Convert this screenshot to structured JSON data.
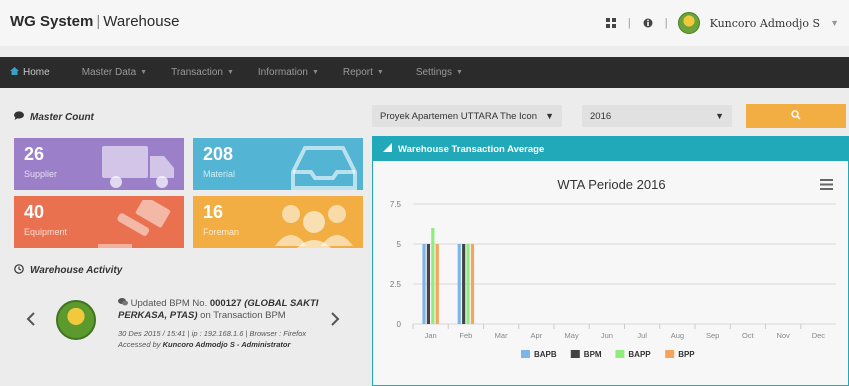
{
  "header": {
    "brand_bold": "WG System",
    "brand_sep": "|",
    "brand_rest": "Warehouse",
    "divider": "|",
    "username": "Kuncoro Admodjo S"
  },
  "nav": {
    "items": [
      {
        "label": "Home",
        "icon": "home-icon"
      },
      {
        "label": "Master Data"
      },
      {
        "label": "Transaction"
      },
      {
        "label": "Information"
      },
      {
        "label": "Report"
      },
      {
        "label": "Settings"
      }
    ]
  },
  "master": {
    "title": "Master Count",
    "tiles": [
      {
        "value": "26",
        "label": "Supplier",
        "color": "#9c7fc9",
        "icon": "truck-icon"
      },
      {
        "value": "208",
        "label": "Material",
        "color": "#54b4d4",
        "icon": "inbox-tray-icon"
      },
      {
        "value": "40",
        "label": "Equipment",
        "color": "#e9714f",
        "icon": "hammer-icon"
      },
      {
        "value": "16",
        "label": "Foreman",
        "color": "#f2ae42",
        "icon": "users-icon"
      }
    ]
  },
  "activity": {
    "title": "Warehouse Activity",
    "line_prefix": "Updated BPM No. ",
    "doc_no": "000127",
    "company": "(GLOBAL SAKTI PERKASA, PTAS)",
    "line_suffix": "on Transaction BPM",
    "meta_line": "30 Des 2015 / 15:41 | ip : 192.168.1.6 | Browser : Firefox",
    "accessed_prefix": "Accessed by ",
    "accessed_by": "Kuncoro Admodjo S - Administrator"
  },
  "filters": {
    "project": "Proyek Apartemen UTTARA The Icon",
    "year": "2016"
  },
  "chart_panel": {
    "header": "Warehouse Transaction Average"
  },
  "chart_data": {
    "type": "bar",
    "title": "WTA Periode 2016",
    "categories": [
      "Jan",
      "Feb",
      "Mar",
      "Apr",
      "May",
      "Jun",
      "Jul",
      "Aug",
      "Sep",
      "Oct",
      "Nov",
      "Dec"
    ],
    "ylim": [
      0,
      7.5
    ],
    "yticks": [
      "0",
      "2.5",
      "5",
      "7.5"
    ],
    "series": [
      {
        "name": "BAPB",
        "color": "#7cb5ec",
        "values": [
          5,
          5,
          0,
          0,
          0,
          0,
          0,
          0,
          0,
          0,
          0,
          0
        ]
      },
      {
        "name": "BPM",
        "color": "#434348",
        "values": [
          5,
          5,
          0,
          0,
          0,
          0,
          0,
          0,
          0,
          0,
          0,
          0
        ]
      },
      {
        "name": "BAPP",
        "color": "#90ed7d",
        "values": [
          6,
          5,
          0,
          0,
          0,
          0,
          0,
          0,
          0,
          0,
          0,
          0
        ]
      },
      {
        "name": "BPP",
        "color": "#f7a35c",
        "values": [
          5,
          5,
          0,
          0,
          0,
          0,
          0,
          0,
          0,
          0,
          0,
          0
        ]
      }
    ],
    "legend": "bottom-center",
    "grid": true
  }
}
